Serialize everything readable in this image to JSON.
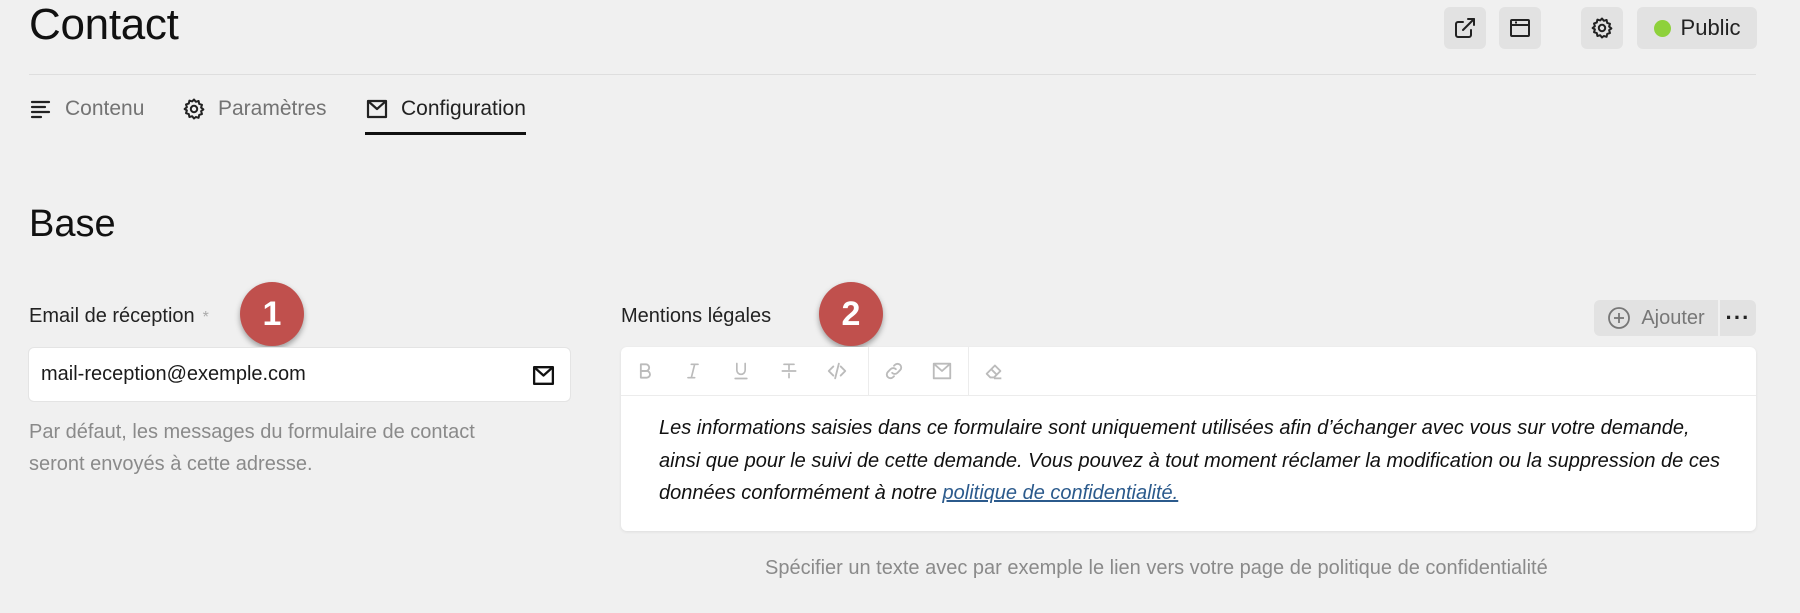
{
  "page": {
    "title": "Contact"
  },
  "header_actions": {
    "external_link_icon": "external-link-icon",
    "window_icon": "browser-window-icon",
    "settings_icon": "gear-icon",
    "status_label": "Public",
    "status_color": "#8ed13b"
  },
  "tabs": [
    {
      "label": "Contenu",
      "icon": "align-left-icon",
      "active": false
    },
    {
      "label": "Paramètres",
      "icon": "gear-icon",
      "active": false
    },
    {
      "label": "Configuration",
      "icon": "mail-icon",
      "active": true
    }
  ],
  "section": {
    "title": "Base"
  },
  "email_field": {
    "label": "Email de réception",
    "required_mark": "*",
    "value": "mail-reception@exemple.com",
    "icon": "mail-icon",
    "help_line1": "Par défaut, les messages du formulaire de contact",
    "help_line2": "seront envoyés à cette adresse."
  },
  "legal_field": {
    "label": "Mentions légales",
    "add_label": "Ajouter",
    "more_label": "···",
    "toolbar": [
      "bold-icon",
      "italic-icon",
      "underline-icon",
      "strikethrough-icon",
      "code-icon",
      "link-icon",
      "mail-icon",
      "eraser-icon"
    ],
    "content_text": "Les informations saisies dans ce formulaire sont uniquement utilisées afin d’échanger avec vous sur votre demande, ainsi que pour le suivi de cette demande. Vous pouvez à tout moment réclamer la modification ou la suppression de ces données conformément à notre ",
    "content_link": "politique de confidentialité.",
    "help": "Spécifier un texte avec par exemple le lien vers votre page de politique de confidentialité"
  },
  "markers": [
    {
      "number": "1",
      "color": "#c0504d"
    },
    {
      "number": "2",
      "color": "#c0504d"
    }
  ]
}
